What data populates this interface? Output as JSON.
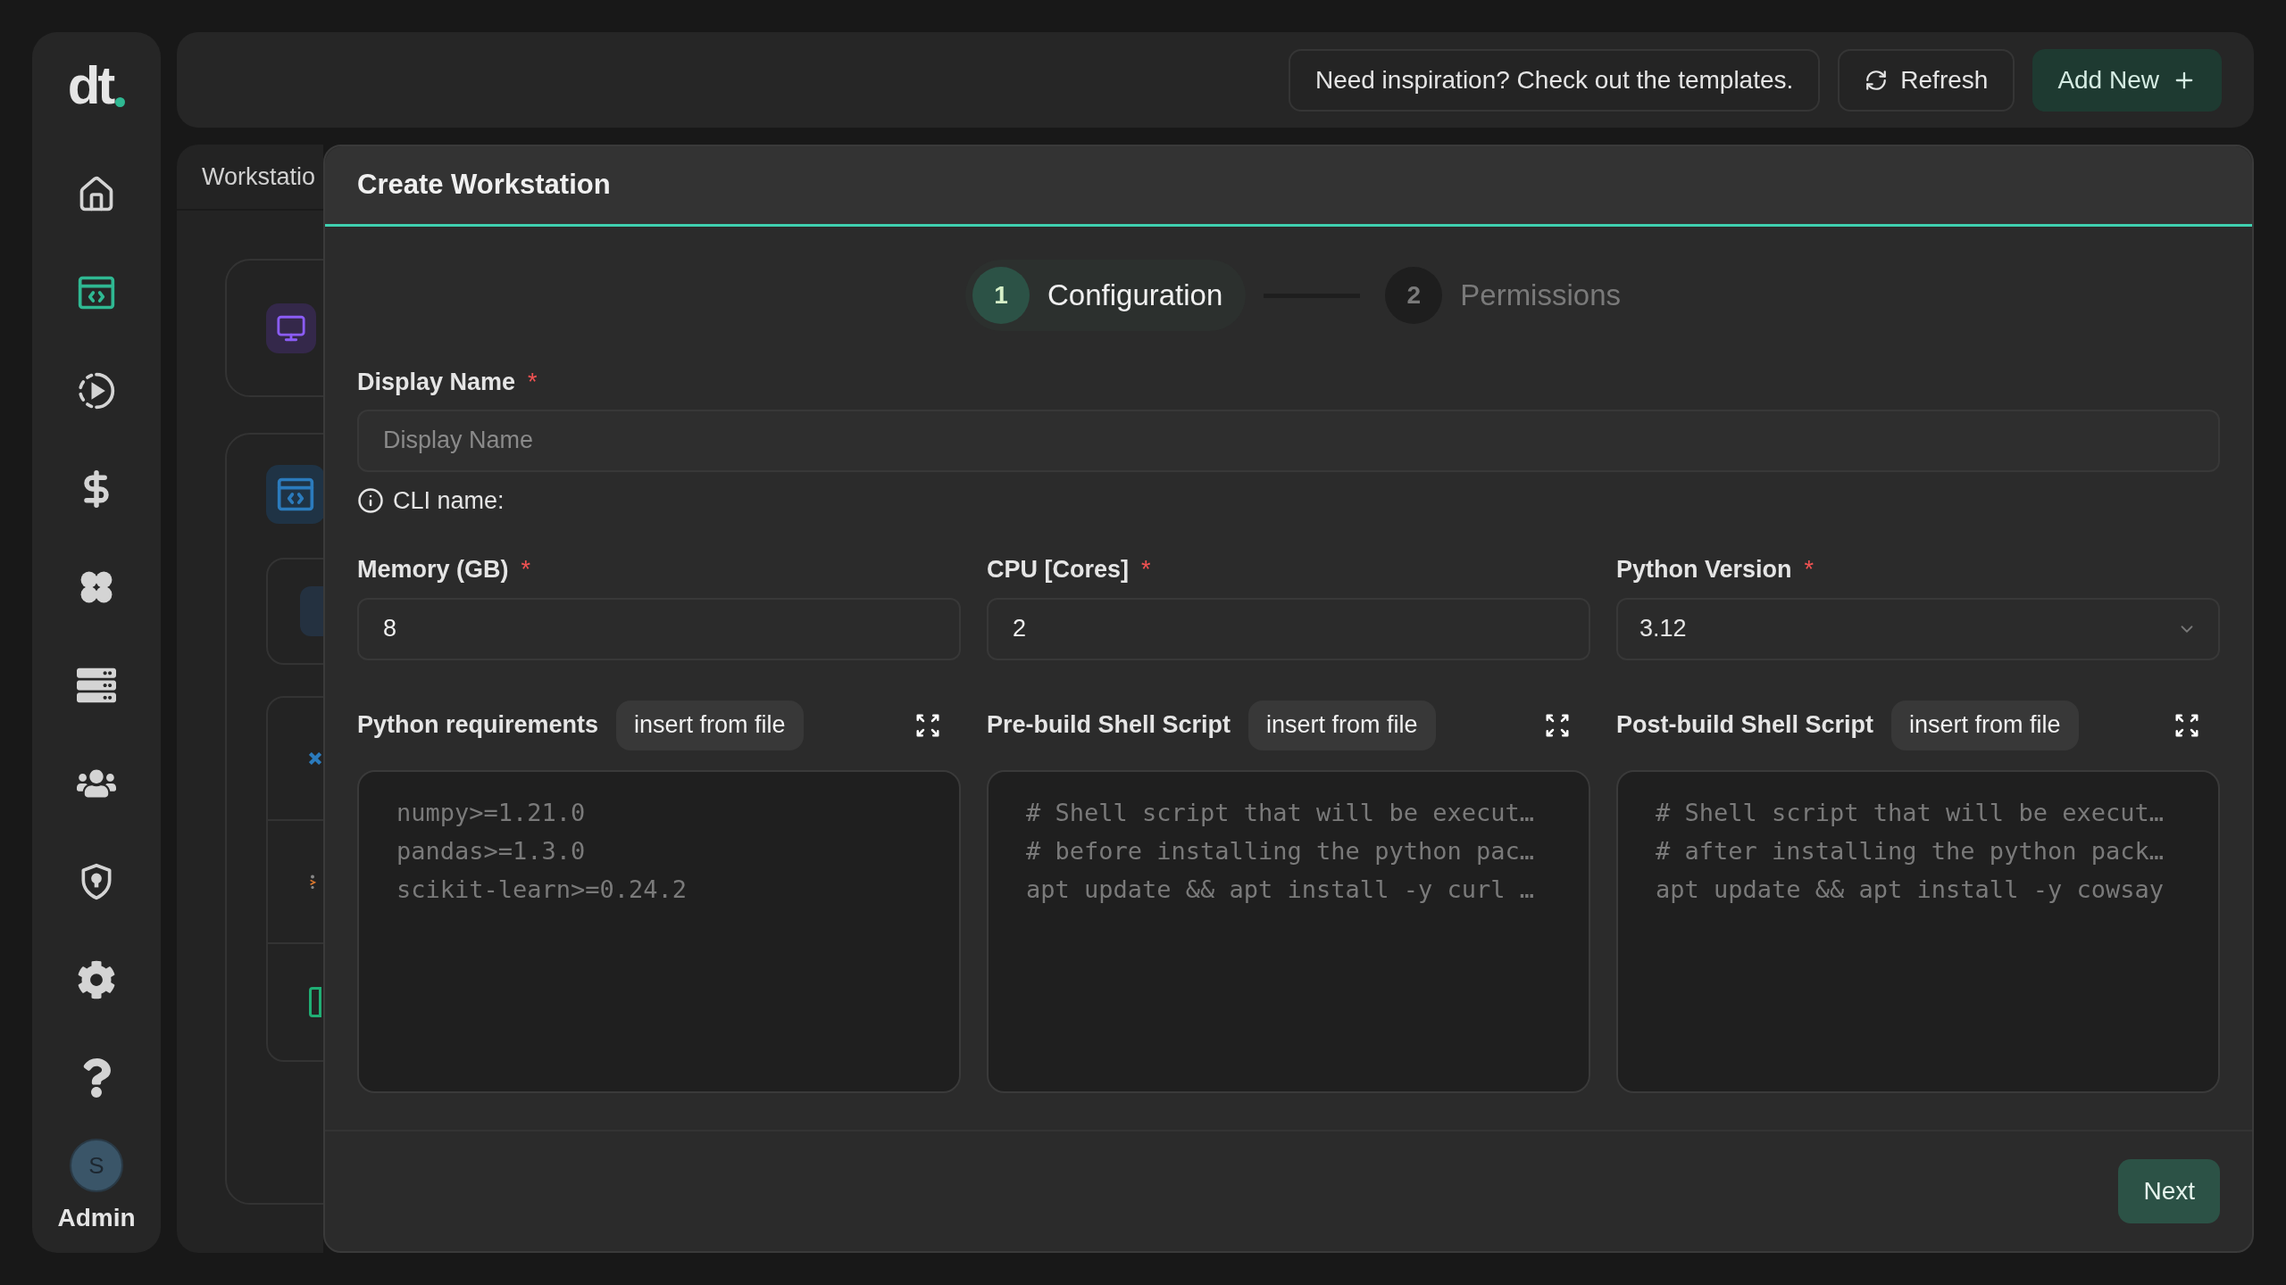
{
  "sidebar": {
    "logo": "dt",
    "avatar": "S",
    "user": "Admin",
    "items": [
      {
        "selected": false
      },
      {
        "selected": true
      },
      {
        "selected": false
      },
      {
        "selected": false
      },
      {
        "selected": false
      },
      {
        "selected": false
      },
      {
        "selected": false
      },
      {
        "selected": false
      },
      {
        "selected": false
      },
      {
        "selected": false
      }
    ]
  },
  "top_bar": {
    "buttons": [
      {
        "label": "Need inspiration? Check out the templates.",
        "kind": "outline"
      },
      {
        "label": "Refresh",
        "kind": "refresh"
      },
      {
        "label": "Add New",
        "kind": "primary"
      }
    ]
  },
  "background_panel": {
    "tab": "Workstatio"
  },
  "dialog": {
    "title": "Create Workstation",
    "steps": [
      {
        "number": "1",
        "label": "Configuration",
        "selected": true
      },
      {
        "number": "2",
        "label": "Permissions",
        "selected": false
      }
    ],
    "display_name": {
      "label": "Display Name",
      "required_mark": "*",
      "placeholder": "Display Name"
    },
    "cli_name": {
      "label": "CLI name:"
    },
    "fields": [
      {
        "label": "Memory (GB)",
        "required_mark": "*",
        "value": "8",
        "kind": "input"
      },
      {
        "label": "CPU [Cores]",
        "required_mark": "*",
        "value": "2",
        "kind": "input"
      },
      {
        "label": "Python Version",
        "required_mark": "*",
        "value": "3.12",
        "kind": "select"
      }
    ],
    "scripts": [
      {
        "label": "Python requirements",
        "button": "insert from file",
        "placeholder": "numpy>=1.21.0\npandas>=1.3.0\nscikit-learn>=0.24.2"
      },
      {
        "label": "Pre-build Shell Script",
        "button": "insert from file",
        "placeholder": "# Shell script that will be execut…\n# before installing the python pac…\napt update && apt install -y curl …"
      },
      {
        "label": "Post-build Shell Script",
        "button": "insert from file",
        "placeholder": "# Shell script that will be execut…\n# after installing the python pack…\napt update && apt install -y cowsay"
      }
    ],
    "next_button": "Next"
  }
}
